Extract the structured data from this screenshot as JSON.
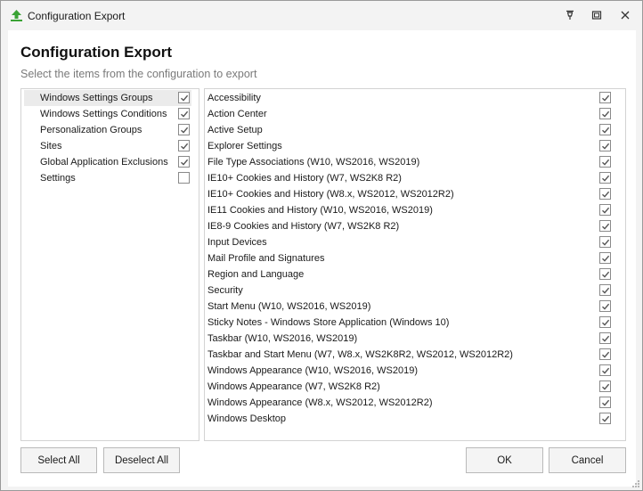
{
  "window": {
    "title": "Configuration Export"
  },
  "header": {
    "title": "Configuration Export",
    "subtitle": "Select the items from the configuration to export"
  },
  "categories": [
    {
      "label": "Windows Settings Groups",
      "checked": true,
      "selected": true
    },
    {
      "label": "Windows Settings Conditions",
      "checked": true,
      "selected": false
    },
    {
      "label": "Personalization Groups",
      "checked": true,
      "selected": false
    },
    {
      "label": "Sites",
      "checked": true,
      "selected": false
    },
    {
      "label": "Global Application Exclusions",
      "checked": true,
      "selected": false
    },
    {
      "label": "Settings",
      "checked": false,
      "selected": false
    }
  ],
  "items": [
    {
      "label": "Accessibility",
      "checked": true
    },
    {
      "label": "Action Center",
      "checked": true
    },
    {
      "label": "Active Setup",
      "checked": true
    },
    {
      "label": "Explorer Settings",
      "checked": true
    },
    {
      "label": "File Type Associations (W10, WS2016, WS2019)",
      "checked": true
    },
    {
      "label": "IE10+ Cookies and History (W7, WS2K8 R2)",
      "checked": true
    },
    {
      "label": "IE10+ Cookies and History (W8.x, WS2012, WS2012R2)",
      "checked": true
    },
    {
      "label": "IE11 Cookies and History (W10, WS2016, WS2019)",
      "checked": true
    },
    {
      "label": "IE8-9 Cookies and History (W7, WS2K8 R2)",
      "checked": true
    },
    {
      "label": "Input Devices",
      "checked": true
    },
    {
      "label": "Mail Profile and Signatures",
      "checked": true
    },
    {
      "label": "Region and Language",
      "checked": true
    },
    {
      "label": "Security",
      "checked": true
    },
    {
      "label": "Start Menu (W10, WS2016, WS2019)",
      "checked": true
    },
    {
      "label": "Sticky Notes - Windows Store Application (Windows 10)",
      "checked": true
    },
    {
      "label": "Taskbar (W10, WS2016, WS2019)",
      "checked": true
    },
    {
      "label": "Taskbar and Start Menu (W7, W8.x, WS2K8R2, WS2012, WS2012R2)",
      "checked": true
    },
    {
      "label": "Windows Appearance (W10, WS2016, WS2019)",
      "checked": true
    },
    {
      "label": "Windows Appearance (W7, WS2K8 R2)",
      "checked": true
    },
    {
      "label": "Windows Appearance (W8.x, WS2012, WS2012R2)",
      "checked": true
    },
    {
      "label": "Windows Desktop",
      "checked": true
    }
  ],
  "buttons": {
    "select_all": "Select All",
    "deselect_all": "Deselect All",
    "ok": "OK",
    "cancel": "Cancel"
  },
  "icons": {
    "app": "upload-arrow-icon",
    "titlebar": [
      "pin-icon",
      "restore-icon",
      "close-icon"
    ]
  },
  "colors": {
    "accent": "#3aa335",
    "check": "#555555"
  }
}
